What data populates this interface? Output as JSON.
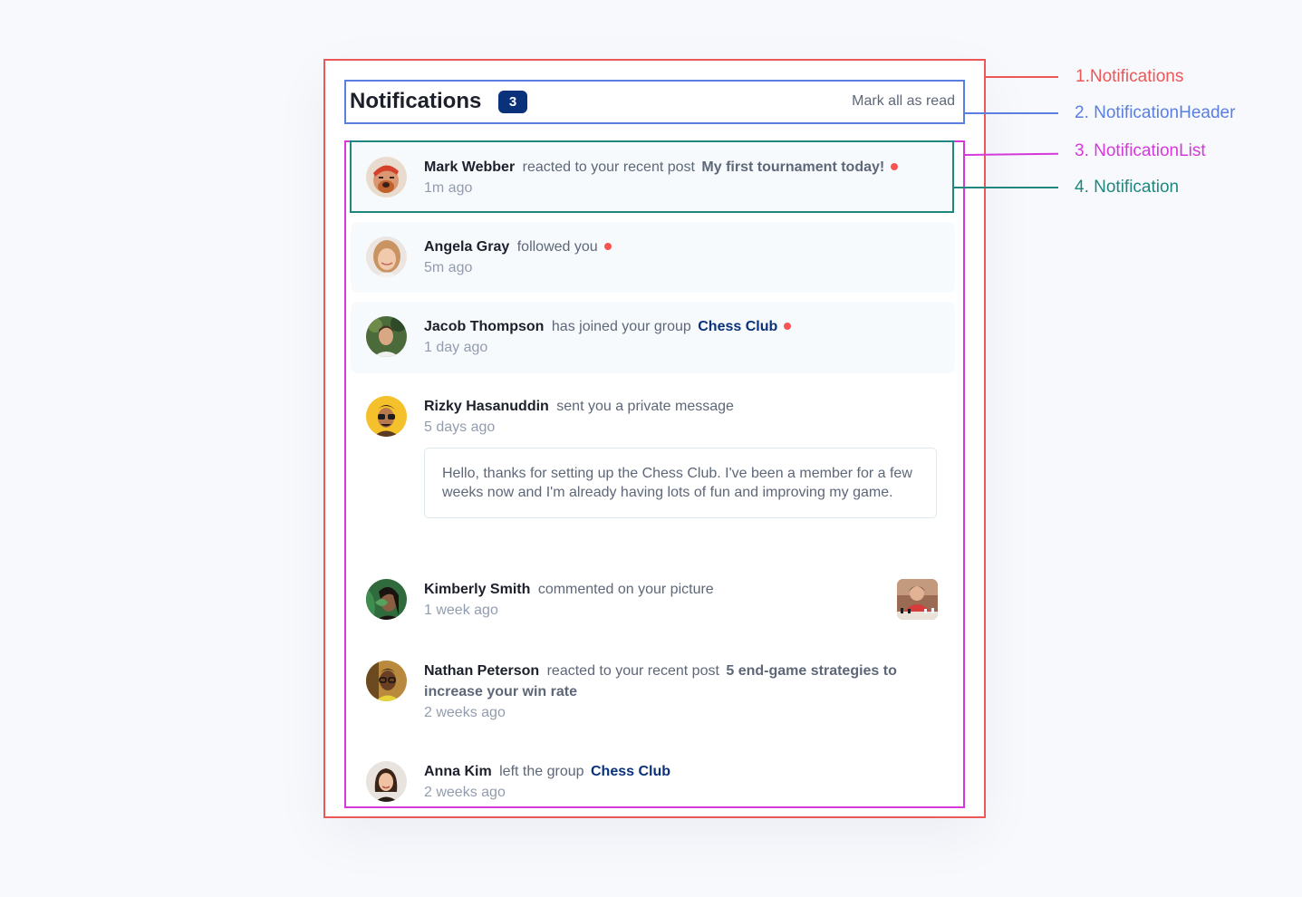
{
  "header": {
    "title": "Notifications",
    "unread_count": "3",
    "mark_all_label": "Mark all as read"
  },
  "notifications": [
    {
      "name": "Mark Webber",
      "action": "reacted to your recent post",
      "post": "My first tournament today!",
      "time": "1m ago",
      "unread": true
    },
    {
      "name": "Angela Gray",
      "action": "followed you",
      "time": "5m ago",
      "unread": true
    },
    {
      "name": "Jacob Thompson",
      "action": "has joined your group",
      "group": "Chess Club",
      "time": "1 day ago",
      "unread": true
    },
    {
      "name": "Rizky Hasanuddin",
      "action": "sent you a private message",
      "time": "5 days ago",
      "message": "Hello, thanks for setting up the Chess Club. I've been a member for a few weeks now and I'm already having lots of fun and improving my game.",
      "unread": false
    },
    {
      "name": "Kimberly Smith",
      "action": "commented on your picture",
      "time": "1 week ago",
      "unread": false
    },
    {
      "name": "Nathan Peterson",
      "action": "reacted to your recent post",
      "post": "5 end-game strategies to increase your win rate",
      "time": "2 weeks ago",
      "unread": false
    },
    {
      "name": "Anna Kim",
      "action": "left the group",
      "group": "Chess Club",
      "time": "2 weeks ago",
      "unread": false
    }
  ],
  "legend": [
    {
      "label": "1.Notifications",
      "color": "#ec5757"
    },
    {
      "label": "2. NotificationHeader",
      "color": "#5b7fe0"
    },
    {
      "label": "3. NotificationList",
      "color": "#d539d9"
    },
    {
      "label": "4. Notification",
      "color": "#20877e"
    }
  ],
  "icons": {
    "unread_dot": "unread-dot-icon",
    "avatar": "avatar",
    "commented_picture": "picture-thumbnail"
  }
}
